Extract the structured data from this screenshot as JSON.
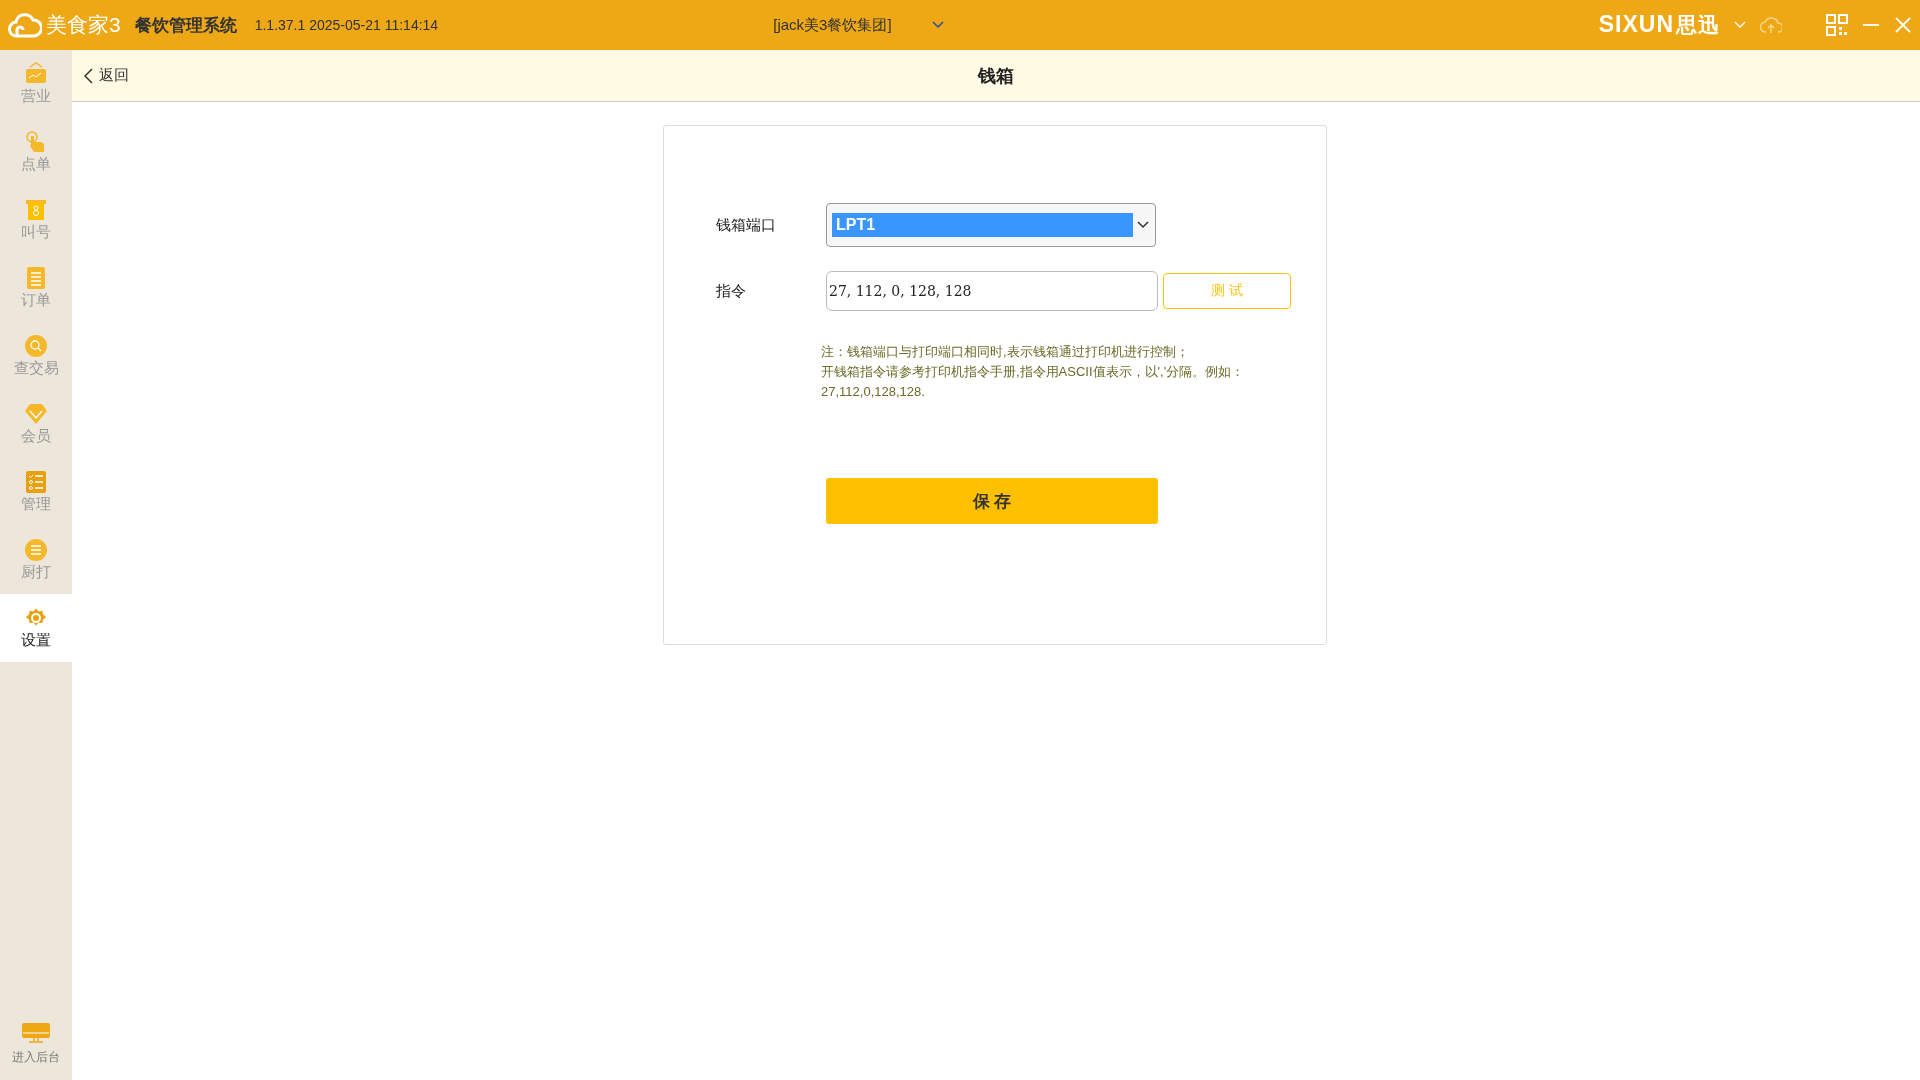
{
  "window": {
    "app_name": "美食家3",
    "system_name": "餐饮管理系统",
    "version": "1.1.37.1 2025-05-21 11:14:14",
    "store": "[jack美3餐饮集团]",
    "brand": "SIXUN",
    "brand_cn": "思迅"
  },
  "sidebar": {
    "items": [
      {
        "label": "营业",
        "selected": false
      },
      {
        "label": "点单",
        "selected": false
      },
      {
        "label": "叫号",
        "selected": false
      },
      {
        "label": "订单",
        "selected": false
      },
      {
        "label": "查交易",
        "selected": false
      },
      {
        "label": "会员",
        "selected": false
      },
      {
        "label": "管理",
        "selected": false
      },
      {
        "label": "厨打",
        "selected": false
      },
      {
        "label": "设置",
        "selected": true
      }
    ],
    "footer": "进入后台"
  },
  "header": {
    "back": "返回",
    "title": "钱箱"
  },
  "form": {
    "port": {
      "label": "钱箱端口",
      "value": "LPT1"
    },
    "command": {
      "label": "指令",
      "value": "27, 112, 0, 128, 128",
      "button": "测 试"
    },
    "notes": [
      "注：钱箱端口与打印端口相同时,表示钱箱通过打印机进行控制；",
      "开钱箱指令请参考打印机指令手册,指令用ASCII值表示，以','分隔。例如：",
      "27,112,0,128,128."
    ],
    "save": "保 存"
  }
}
